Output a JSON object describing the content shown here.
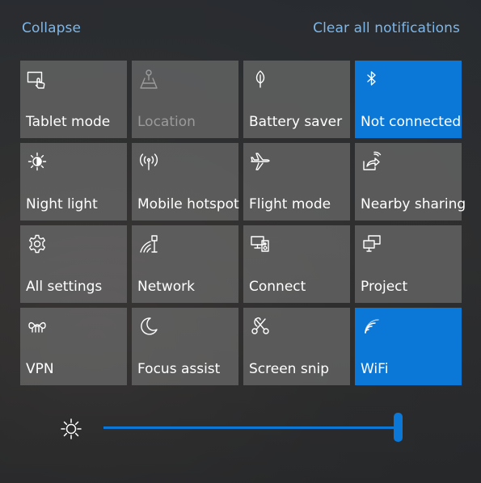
{
  "header": {
    "collapse_label": "Collapse",
    "clear_label": "Clear all notifications"
  },
  "colors": {
    "accent": "#0b78d7",
    "link": "#7db7ea",
    "tile_inactive": "#767676",
    "text": "#ffffff",
    "text_disabled": "#9b9b9b"
  },
  "tiles": [
    {
      "label": "Tablet mode",
      "icon": "tablet-mode-icon",
      "active": false
    },
    {
      "label": "Location",
      "icon": "location-icon",
      "active": false,
      "disabled": true
    },
    {
      "label": "Battery saver",
      "icon": "battery-saver-leaf-icon",
      "active": false
    },
    {
      "label": "Not connected",
      "icon": "bluetooth-icon",
      "active": true
    },
    {
      "label": "Night light",
      "icon": "night-light-sun-icon",
      "active": false
    },
    {
      "label": "Mobile hotspot",
      "icon": "mobile-hotspot-icon",
      "active": false
    },
    {
      "label": "Flight mode",
      "icon": "airplane-icon",
      "active": false
    },
    {
      "label": "Nearby sharing",
      "icon": "nearby-sharing-icon",
      "active": false
    },
    {
      "label": "All settings",
      "icon": "gear-icon",
      "active": false
    },
    {
      "label": "Network",
      "icon": "network-icon",
      "active": false
    },
    {
      "label": "Connect",
      "icon": "connect-devices-icon",
      "active": false
    },
    {
      "label": "Project",
      "icon": "project-display-icon",
      "active": false
    },
    {
      "label": "VPN",
      "icon": "vpn-icon",
      "active": false
    },
    {
      "label": "Focus assist",
      "icon": "moon-icon",
      "active": false
    },
    {
      "label": "Screen snip",
      "icon": "scissors-icon",
      "active": false
    },
    {
      "label": "WiFi",
      "icon": "wifi-icon",
      "active": true
    }
  ],
  "brightness": {
    "icon": "brightness-sun-icon",
    "level": 1.0
  }
}
